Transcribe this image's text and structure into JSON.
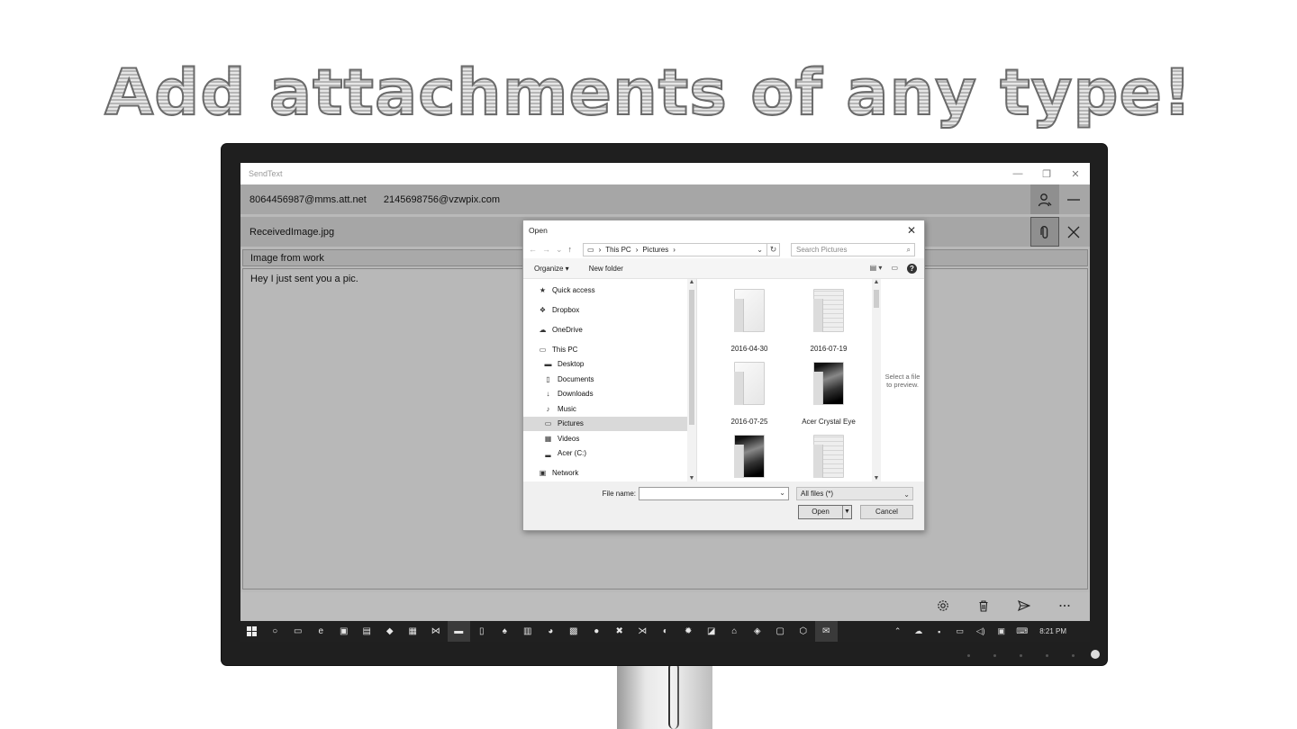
{
  "headline": "Add attachments of any type!",
  "app": {
    "title": "SendText",
    "window_controls": [
      "—",
      "❐",
      "✕"
    ],
    "recipients": [
      "8064456987@mms.att.net",
      "2145698756@vzwpix.com"
    ],
    "attachment_name": "ReceivedImage.jpg",
    "subject": "Image from work",
    "message": "Hey I just sent you a pic."
  },
  "dialog": {
    "title": "Open",
    "breadcrumb": [
      "This PC",
      "Pictures"
    ],
    "search_placeholder": "Search Pictures",
    "organize_label": "Organize ▾",
    "new_folder_label": "New folder",
    "nav_top": [
      {
        "label": "Quick access",
        "icon": "star-icon"
      },
      {
        "label": "Dropbox",
        "icon": "dropbox-icon"
      },
      {
        "label": "OneDrive",
        "icon": "cloud-icon"
      },
      {
        "label": "This PC",
        "icon": "computer-icon"
      }
    ],
    "nav_sub": [
      {
        "label": "Desktop",
        "icon": "desktop-icon"
      },
      {
        "label": "Documents",
        "icon": "document-icon"
      },
      {
        "label": "Downloads",
        "icon": "download-icon"
      },
      {
        "label": "Music",
        "icon": "music-icon"
      },
      {
        "label": "Pictures",
        "icon": "pictures-icon",
        "selected": true
      },
      {
        "label": "Videos",
        "icon": "video-icon"
      },
      {
        "label": "Acer (C:)",
        "icon": "drive-icon"
      }
    ],
    "nav_bottom": {
      "label": "Network",
      "icon": "network-icon"
    },
    "files": [
      {
        "name": "2016-04-30",
        "kind": "folder"
      },
      {
        "name": "2016-07-19",
        "kind": "docs"
      },
      {
        "name": "2016-07-25",
        "kind": "folder"
      },
      {
        "name": "Acer Crystal Eye",
        "kind": "photo"
      },
      {
        "name": "",
        "kind": "photo"
      },
      {
        "name": "",
        "kind": "docs"
      }
    ],
    "preview_text": "Select a file to preview.",
    "file_name_label": "File name:",
    "file_name_value": "",
    "filter": "All files (*)",
    "open_label": "Open",
    "cancel_label": "Cancel"
  },
  "taskbar": {
    "clock": "8:21 PM"
  }
}
